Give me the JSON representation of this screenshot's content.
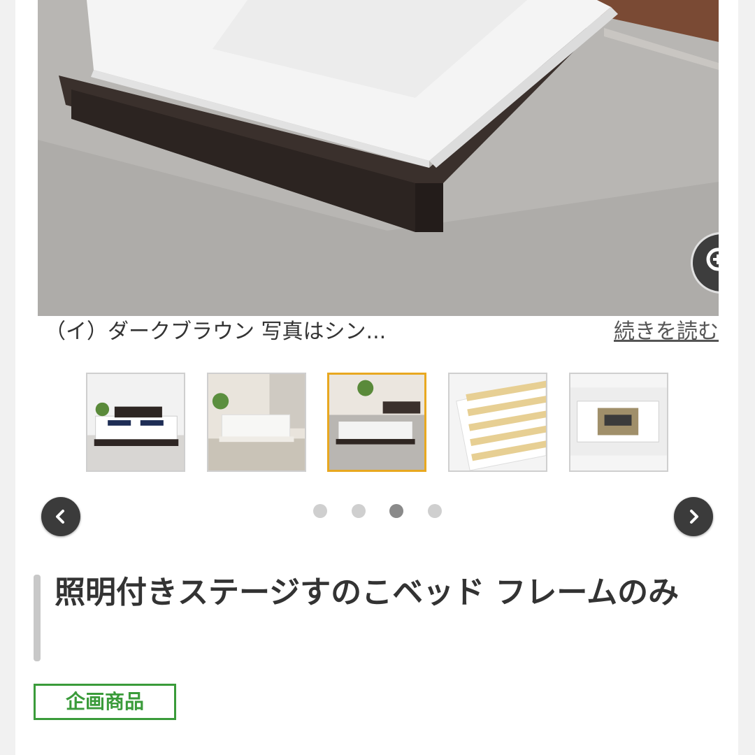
{
  "product": {
    "caption": "（イ）ダークブラウン 写真はシン...",
    "read_more": "続きを読む",
    "title": "照明付きステージすのこベッド フレームのみ",
    "badge": "企画商品"
  },
  "gallery": {
    "thumbnails": [
      {
        "name": "thumbnail-twin-beds"
      },
      {
        "name": "thumbnail-white-bed"
      },
      {
        "name": "thumbnail-dark-brown-bed"
      },
      {
        "name": "thumbnail-slats"
      },
      {
        "name": "thumbnail-headboard-outlet"
      }
    ],
    "selected_index": 2,
    "page_dots": 4,
    "active_dot": 2
  },
  "icons": {
    "zoom": "zoom-in-icon",
    "prev": "chevron-left-icon",
    "next": "chevron-right-icon"
  },
  "colors": {
    "selected_border": "#e8a820",
    "badge_green": "#3a9b3a",
    "arrow_bg": "#3b3b3b"
  }
}
